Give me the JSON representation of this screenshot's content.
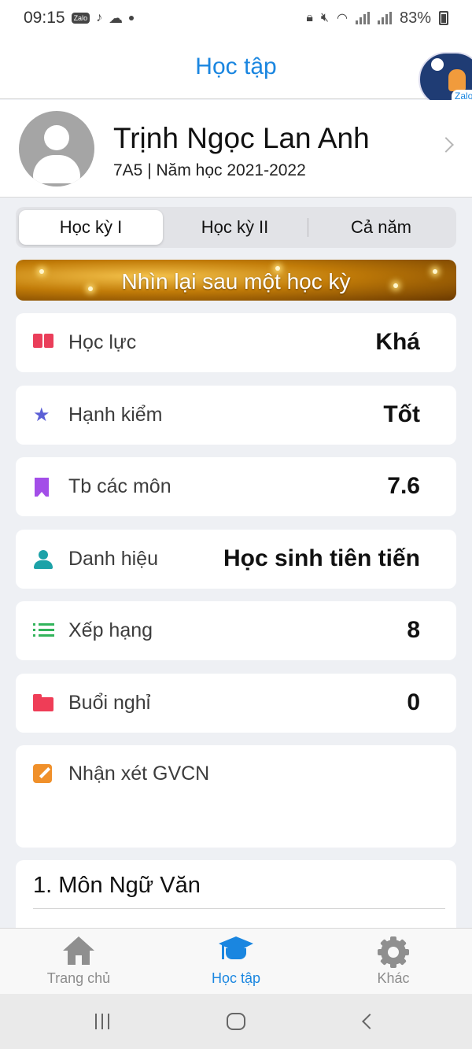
{
  "status_bar": {
    "time": "09:15",
    "app_badge": "Zalo",
    "battery": "83%"
  },
  "header": {
    "title": "Học tập",
    "avatar_badge": "Zalo o o"
  },
  "profile": {
    "name": "Trịnh Ngọc Lan Anh",
    "class_year": "7A5 | Năm học 2021-2022"
  },
  "tabs": [
    {
      "label": "Học kỳ I",
      "selected": true
    },
    {
      "label": "Học kỳ II",
      "selected": false
    },
    {
      "label": "Cả năm",
      "selected": false
    }
  ],
  "banner": {
    "title": "Nhìn lại sau một học kỳ"
  },
  "summary": [
    {
      "icon": "book-icon",
      "label": "Học lực",
      "value": "Khá",
      "color": "#ea3e5a"
    },
    {
      "icon": "star-icon",
      "label": "Hạnh kiểm",
      "value": "Tốt",
      "color": "#5b5fd6"
    },
    {
      "icon": "bookmark-icon",
      "label": "Tb các môn",
      "value": "7.6",
      "color": "#a34ee8"
    },
    {
      "icon": "person-icon",
      "label": "Danh hiệu",
      "value": "Học sinh tiên tiến",
      "color": "#1da2a8"
    },
    {
      "icon": "list-icon",
      "label": "Xếp hạng",
      "value": "8",
      "color": "#32b45b"
    },
    {
      "icon": "folder-icon",
      "label": "Buổi nghỉ",
      "value": "0",
      "color": "#ef3d57"
    }
  ],
  "comment": {
    "icon": "edit-icon",
    "label": "Nhận xét GVCN",
    "color": "#f0902a"
  },
  "subject": {
    "title": "1. Môn Ngữ Văn"
  },
  "bottom_nav": [
    {
      "icon": "home-icon",
      "label": "Trang chủ",
      "active": false
    },
    {
      "icon": "graduation-cap-icon",
      "label": "Học tập",
      "active": true
    },
    {
      "icon": "gear-icon",
      "label": "Khác",
      "active": false
    }
  ],
  "colors": {
    "accent": "#1a86e0",
    "background": "#eef0f4",
    "inactive": "#8c8c8c"
  }
}
